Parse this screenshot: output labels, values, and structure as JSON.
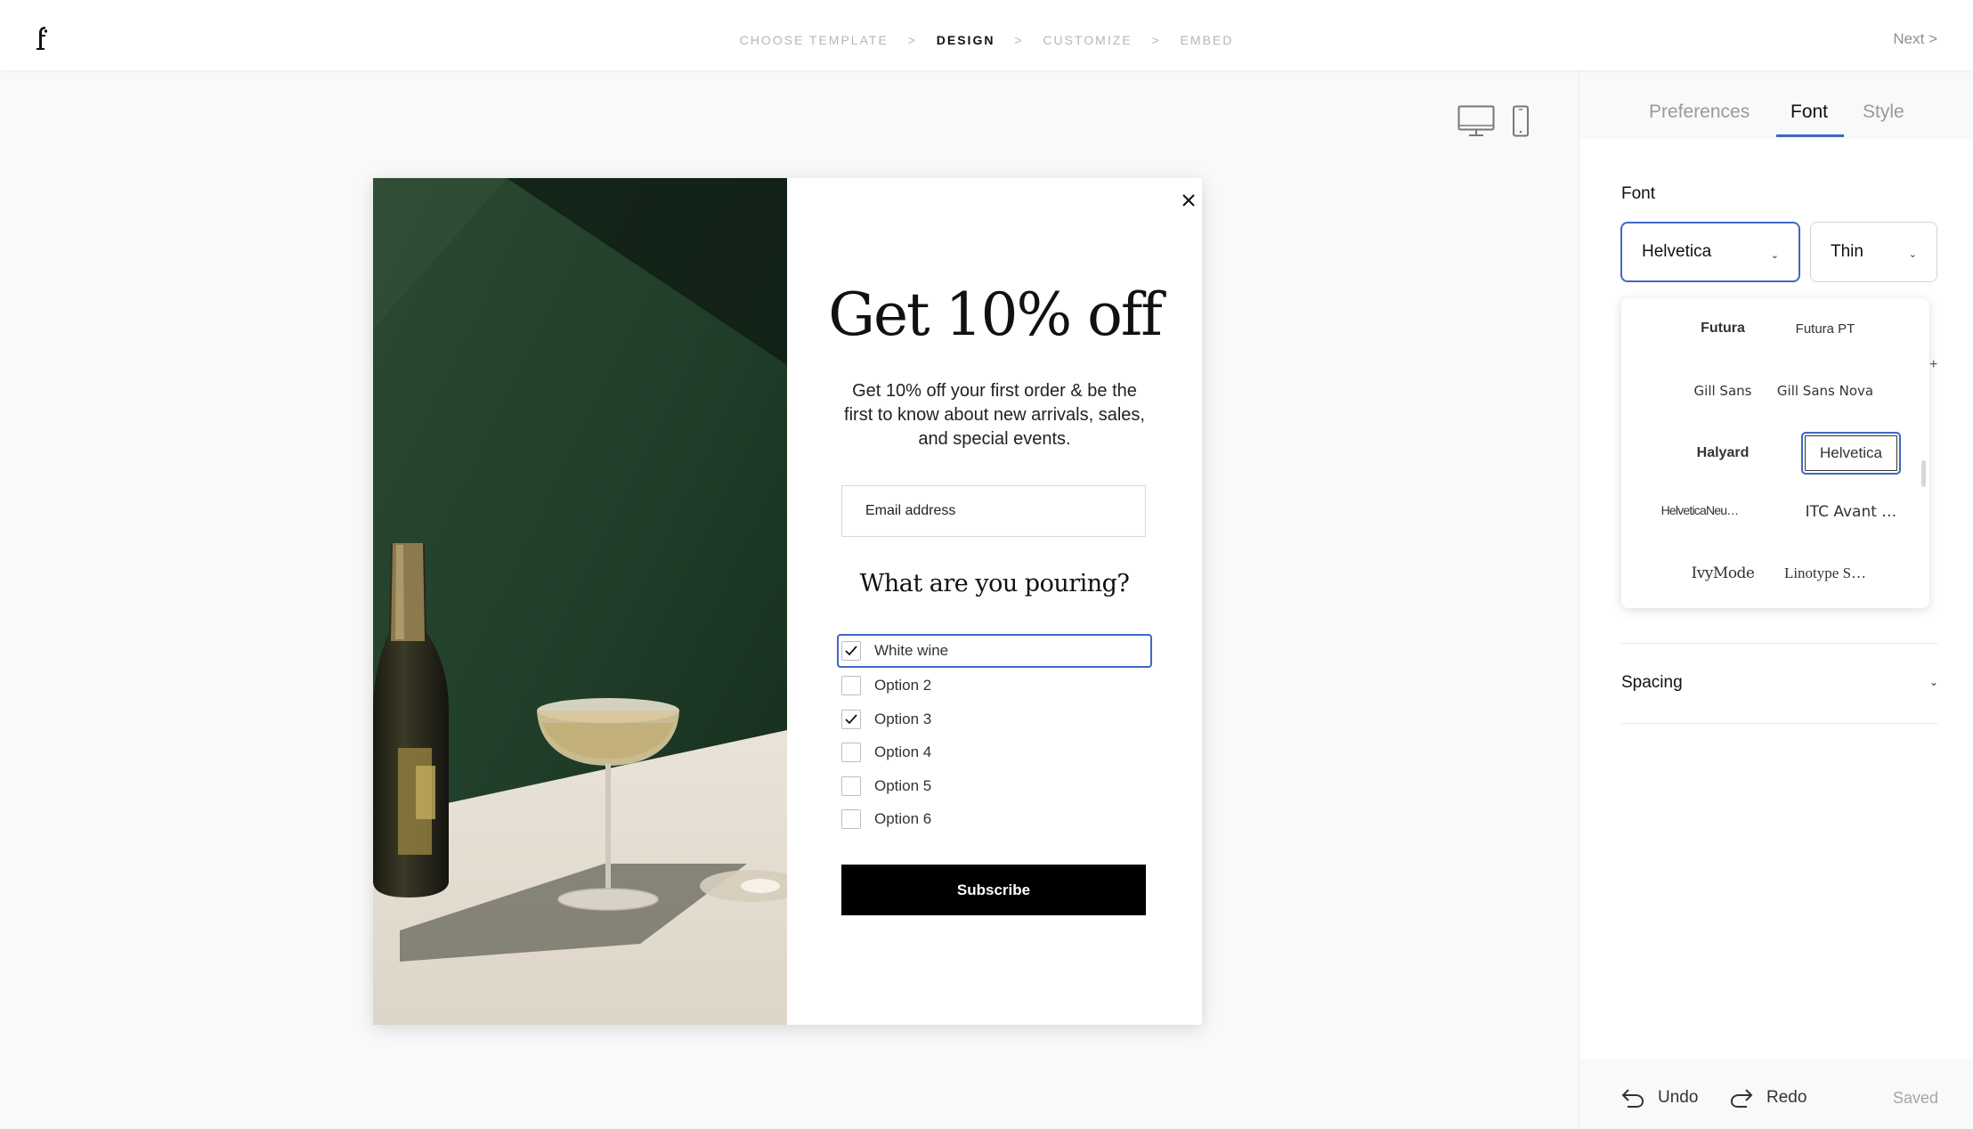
{
  "topbar": {
    "logo_icon": "brand-f-logo",
    "steps": [
      {
        "label": "CHOOSE TEMPLATE",
        "active": false
      },
      {
        "label": "DESIGN",
        "active": true
      },
      {
        "label": "CUSTOMIZE",
        "active": false
      },
      {
        "label": "EMBED",
        "active": false
      }
    ],
    "step_separator": ">",
    "next_label": "Next  >"
  },
  "canvas": {
    "device_icons": [
      "desktop-icon",
      "mobile-icon"
    ]
  },
  "popup": {
    "headline": "Get 10% off",
    "subtext": "Get 10% off your first order & be the first to know about new arrivals, sales, and special events.",
    "email_placeholder": "Email address",
    "question": "What are you pouring?",
    "options": [
      {
        "label": "White wine",
        "checked": true
      },
      {
        "label": "Option 2",
        "checked": false
      },
      {
        "label": "Option 3",
        "checked": true
      },
      {
        "label": "Option 4",
        "checked": false
      },
      {
        "label": "Option 5",
        "checked": false
      },
      {
        "label": "Option 6",
        "checked": false
      }
    ],
    "subscribe_label": "Subscribe",
    "colors": {
      "button_bg": "#000000",
      "image_wall": "#1f3d28",
      "image_floor": "#ece6dc"
    }
  },
  "panel": {
    "tabs": [
      {
        "label": "Preferences",
        "active": false
      },
      {
        "label": "Font",
        "active": true
      },
      {
        "label": "Style",
        "active": false
      }
    ],
    "font_label": "Font",
    "font_family_value": "Helvetica",
    "font_weight_value": "Thin",
    "font_options": [
      [
        "Futura",
        "Futura PT"
      ],
      [
        "Gill Sans",
        "Gill Sans Nova"
      ],
      [
        "Halyard",
        "Helvetica"
      ],
      [
        "HelveticaNeu…",
        "ITC Avant …"
      ],
      [
        "IvyMode",
        "Linotype S…"
      ]
    ],
    "selected_font": "Helvetica",
    "spacing_label": "Spacing",
    "undo_label": "Undo",
    "redo_label": "Redo",
    "status": "Saved",
    "accent_color": "#3f68c4"
  }
}
